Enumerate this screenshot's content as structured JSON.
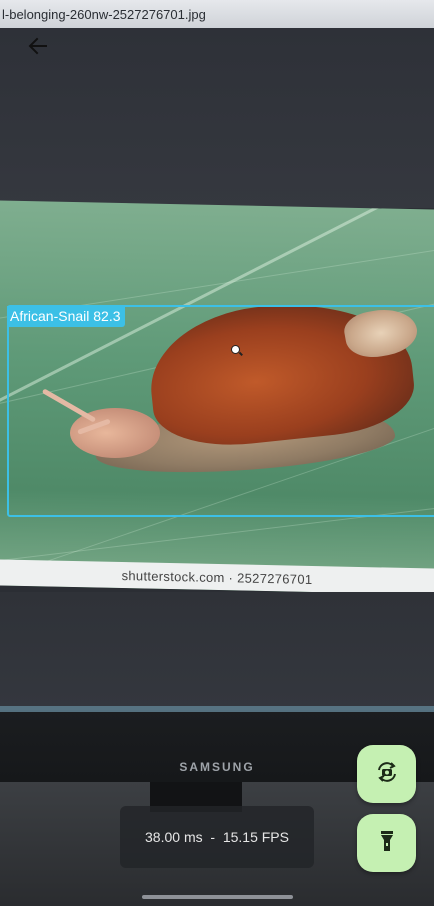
{
  "header": {
    "filename": "l-belonging-260nw-2527276701.jpg",
    "back_icon": "arrow-left-icon"
  },
  "photo": {
    "watermark": "shutterstock.com · 2527276701"
  },
  "detection": {
    "label": "African-Snail 82.3",
    "color": "#3cc0e6"
  },
  "monitor": {
    "brand": "SAMSUNG"
  },
  "controls": {
    "switch_camera_icon": "camera-switch-icon",
    "flashlight_icon": "flashlight-icon",
    "accent": "#c5f0b2"
  },
  "stats": {
    "text": "38.00 ms  -  15.15 FPS"
  }
}
